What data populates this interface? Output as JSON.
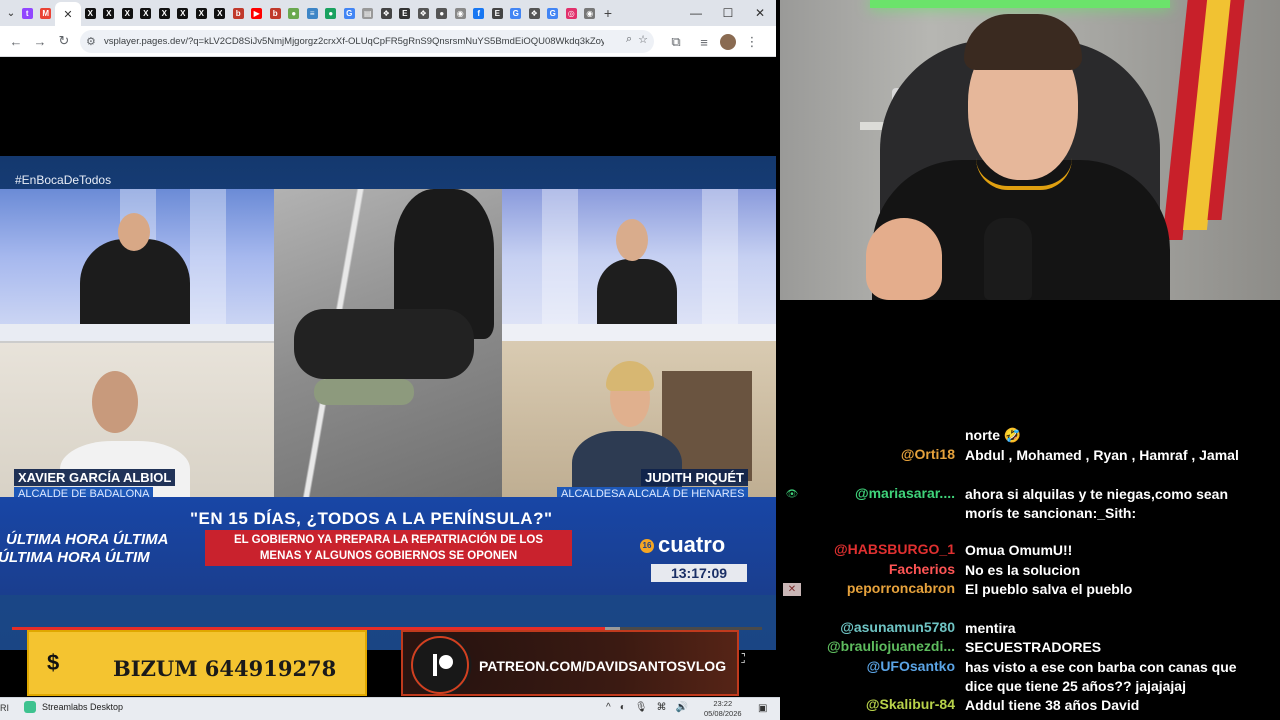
{
  "browser": {
    "tab_favicons": [
      {
        "icon": "twitch-icon",
        "color": "#9146ff",
        "glyph": "t"
      },
      {
        "icon": "gmail-icon",
        "color": "#ea4335",
        "glyph": "M"
      },
      {
        "icon": "x-icon",
        "color": "#111111",
        "glyph": "X"
      },
      {
        "icon": "x-icon",
        "color": "#111111",
        "glyph": "X"
      },
      {
        "icon": "x-icon",
        "color": "#111111",
        "glyph": "X"
      },
      {
        "icon": "x-icon",
        "color": "#111111",
        "glyph": "X"
      },
      {
        "icon": "x-icon",
        "color": "#111111",
        "glyph": "X"
      },
      {
        "icon": "x-icon",
        "color": "#111111",
        "glyph": "X"
      },
      {
        "icon": "x-icon",
        "color": "#111111",
        "glyph": "X"
      },
      {
        "icon": "x-icon",
        "color": "#111111",
        "glyph": "X"
      },
      {
        "icon": "site-icon",
        "color": "#c0392b",
        "glyph": "b"
      },
      {
        "icon": "youtube-icon",
        "color": "#ff0000",
        "glyph": "▶"
      },
      {
        "icon": "site-icon",
        "color": "#c0392b",
        "glyph": "b"
      },
      {
        "icon": "site-icon",
        "color": "#6aa84f",
        "glyph": "●"
      },
      {
        "icon": "site-icon",
        "color": "#3d85c6",
        "glyph": "≡"
      },
      {
        "icon": "site-icon",
        "color": "#1aa260",
        "glyph": "●"
      },
      {
        "icon": "google-icon",
        "color": "#4285f4",
        "glyph": "G"
      },
      {
        "icon": "docs-icon",
        "color": "#999999",
        "glyph": "▤"
      },
      {
        "icon": "site-icon",
        "color": "#444444",
        "glyph": "❖"
      },
      {
        "icon": "site-icon",
        "color": "#333333",
        "glyph": "E"
      },
      {
        "icon": "site-icon",
        "color": "#555555",
        "glyph": "❖"
      },
      {
        "icon": "site-icon",
        "color": "#555555",
        "glyph": "●"
      },
      {
        "icon": "site-icon",
        "color": "#888888",
        "glyph": "◉"
      },
      {
        "icon": "facebook-icon",
        "color": "#1877f2",
        "glyph": "f"
      },
      {
        "icon": "site-icon",
        "color": "#444444",
        "glyph": "E"
      },
      {
        "icon": "google-icon",
        "color": "#4285f4",
        "glyph": "G"
      },
      {
        "icon": "site-icon",
        "color": "#555555",
        "glyph": "❖"
      },
      {
        "icon": "google-icon",
        "color": "#4285f4",
        "glyph": "G"
      },
      {
        "icon": "instagram-icon",
        "color": "#e1306c",
        "glyph": "◎"
      },
      {
        "icon": "site-icon",
        "color": "#777777",
        "glyph": "◉"
      }
    ],
    "active_tab_close": "✕",
    "new_tab": "+",
    "window_controls": {
      "minimize": "—",
      "maximize": "☐",
      "close": "✕"
    },
    "nav": {
      "back": "←",
      "forward": "→",
      "reload": "↻",
      "site_info": "⚙"
    },
    "url": "vsplayer.pages.dev/?q=kLV2CD8SiJv5NmjMjgorgz2crxXf-OLUqCpFR5gRnS9QnsrsmNuYS5BmdEiOQU08Wkdq3kZoy8jF...",
    "omnibox_icons": {
      "zoom": "⌕",
      "bookmark": "☆"
    },
    "toolbar_icons": {
      "extensions": "⧉",
      "media": "≡",
      "menu": "⋮"
    }
  },
  "broadcast": {
    "hashtag": "#EnBocaDeTodos",
    "guest_left_name": "XAVIER GARCÍA ALBIOL",
    "guest_left_role": "ALCALDE DE BADALONA",
    "guest_right_name": "JUDITH PIQUÉT",
    "guest_right_role": "ALCALDESA ALCALÁ DE HENARES",
    "headline": "\"EN 15 DÍAS, ¿TODOS A LA PENÍNSULA?\"",
    "subheadline_line1": "EL GOBIERNO YA PREPARA LA REPATRIACIÓN DE LOS",
    "subheadline_line2": "MENAS Y ALGUNOS GOBIERNOS SE OPONEN",
    "ticker_top": "ÚLTIMA HORA   ÚLTIMA",
    "ticker_bottom": "ÚLTIMA HORA   ÚLTIM",
    "channel_number": "16",
    "channel": "cuatro",
    "clock": "13:17:09"
  },
  "player": {
    "progress_fraction": 0.79,
    "buffer_fraction": 0.81,
    "fullscreen_icon": "⛶"
  },
  "banners": {
    "bizum_symbol": "$",
    "bizum": "BIZUM 644919278",
    "patreon": "PATREON.COM/DAVIDSANTOSVLOG"
  },
  "taskbar": {
    "left_label": "RI",
    "app": "Streamlabs Desktop",
    "tray_icons": [
      "^",
      "◐",
      "🎙",
      "⌘",
      "🔊"
    ],
    "time": "23:22",
    "date": "05/08/2026"
  },
  "chat": [
    {
      "name": "",
      "color": "#ffffff",
      "message": "norte 🤣",
      "badge": ""
    },
    {
      "name": "@Orti18",
      "color": "#e6a23c",
      "message": "Abdul , Mohamed , Ryan , Hamraf , Jamal",
      "badge": ""
    },
    {
      "name": "@mariasarar....",
      "color": "#3fd37a",
      "message": "ahora si alquilas y te niegas,como sean morís te sancionan:_Sith:",
      "badge": "👁"
    },
    {
      "name": "@HABSBURGO_1",
      "color": "#e03030",
      "message": "Omua OmumU!!",
      "badge": ""
    },
    {
      "name": "Facherios",
      "color": "#ff5555",
      "message": "No es la solucion",
      "badge": ""
    },
    {
      "name": "peporroncabron",
      "color": "#e6a23c",
      "message": "El pueblo salva el pueblo",
      "badge": "✕"
    },
    {
      "name": "@asunamun5780",
      "color": "#6fc4c4",
      "message": "mentira",
      "badge": ""
    },
    {
      "name": "@brauliojuanezdi...",
      "color": "#5ebc5e",
      "message": "SECUESTRADORES",
      "badge": ""
    },
    {
      "name": "@UFOsantko",
      "color": "#5ba4e6",
      "message": "has visto a ese con barba con canas que dice que tiene 25 años?? jajajajaj",
      "badge": ""
    },
    {
      "name": "@Skalibur-84",
      "color": "#b8d24a",
      "message": "Addul tiene 38 años David",
      "badge": ""
    }
  ]
}
